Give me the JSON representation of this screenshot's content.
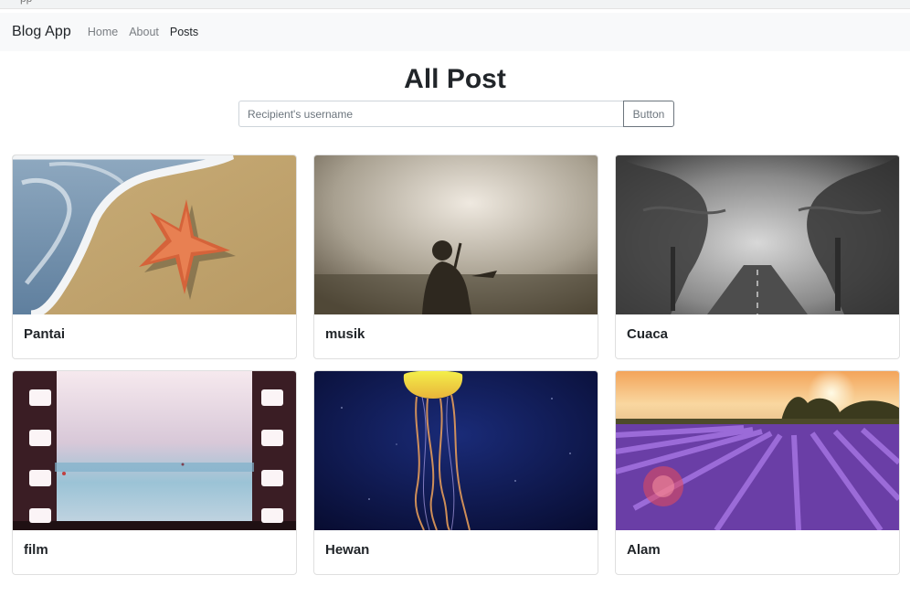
{
  "navbar": {
    "brand": "Blog App",
    "links": [
      {
        "label": "Home",
        "active": false
      },
      {
        "label": "About",
        "active": false
      },
      {
        "label": "Posts",
        "active": true
      }
    ]
  },
  "main": {
    "title": "All Post",
    "search": {
      "placeholder": "Recipient's username",
      "value": "",
      "button_label": "Button"
    }
  },
  "posts": [
    {
      "title": "Pantai",
      "image": "starfish-on-beach"
    },
    {
      "title": "musik",
      "image": "guitarist-in-fog"
    },
    {
      "title": "Cuaca",
      "image": "foggy-forest-road"
    },
    {
      "title": "film",
      "image": "film-strip-beach"
    },
    {
      "title": "Hewan",
      "image": "glowing-jellyfish"
    },
    {
      "title": "Alam",
      "image": "lavender-field-sunset"
    }
  ]
}
